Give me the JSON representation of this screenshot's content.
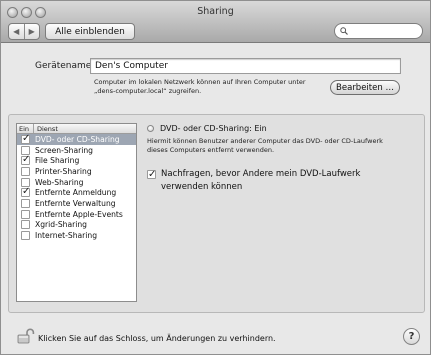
{
  "window": {
    "title": "Sharing"
  },
  "toolbar": {
    "back_glyph": "◀",
    "forward_glyph": "▶",
    "show_all_label": "Alle einblenden",
    "search": {
      "value": "",
      "placeholder": ""
    }
  },
  "computer_name": {
    "label": "Gerätename:",
    "value": "Den's Computer",
    "info_line1": "Computer im lokalen Netzwerk können auf Ihren Computer unter",
    "info_line2": "„dens-computer.local“ zugreifen.",
    "edit_label": "Bearbeiten …"
  },
  "services": {
    "col_on": "Ein",
    "col_service": "Dienst",
    "items": [
      {
        "label": "DVD- oder CD-Sharing",
        "checked": true,
        "selected": true
      },
      {
        "label": "Screen-Sharing",
        "checked": false,
        "selected": false
      },
      {
        "label": "File Sharing",
        "checked": true,
        "selected": false
      },
      {
        "label": "Printer-Sharing",
        "checked": false,
        "selected": false
      },
      {
        "label": "Web-Sharing",
        "checked": false,
        "selected": false
      },
      {
        "label": "Entfernte Anmeldung",
        "checked": true,
        "selected": false
      },
      {
        "label": "Entfernte Verwaltung",
        "checked": false,
        "selected": false
      },
      {
        "label": "Entfernte Apple-Events",
        "checked": false,
        "selected": false
      },
      {
        "label": "Xgrid-Sharing",
        "checked": false,
        "selected": false
      },
      {
        "label": "Internet-Sharing",
        "checked": false,
        "selected": false
      }
    ]
  },
  "detail": {
    "status": "DVD- oder CD-Sharing: Ein",
    "description_line1": "Hiermit können Benutzer anderer Computer das DVD- oder CD-Laufwerk",
    "description_line2": "dieses Computers entfernt verwenden.",
    "ask_line1": "Nachfragen, bevor Andere mein DVD-Laufwerk",
    "ask_line2": "verwenden können",
    "ask_checked": true
  },
  "footer": {
    "lock_text": "Klicken Sie auf das Schloss, um Änderungen zu verhindern.",
    "help_glyph": "?"
  }
}
